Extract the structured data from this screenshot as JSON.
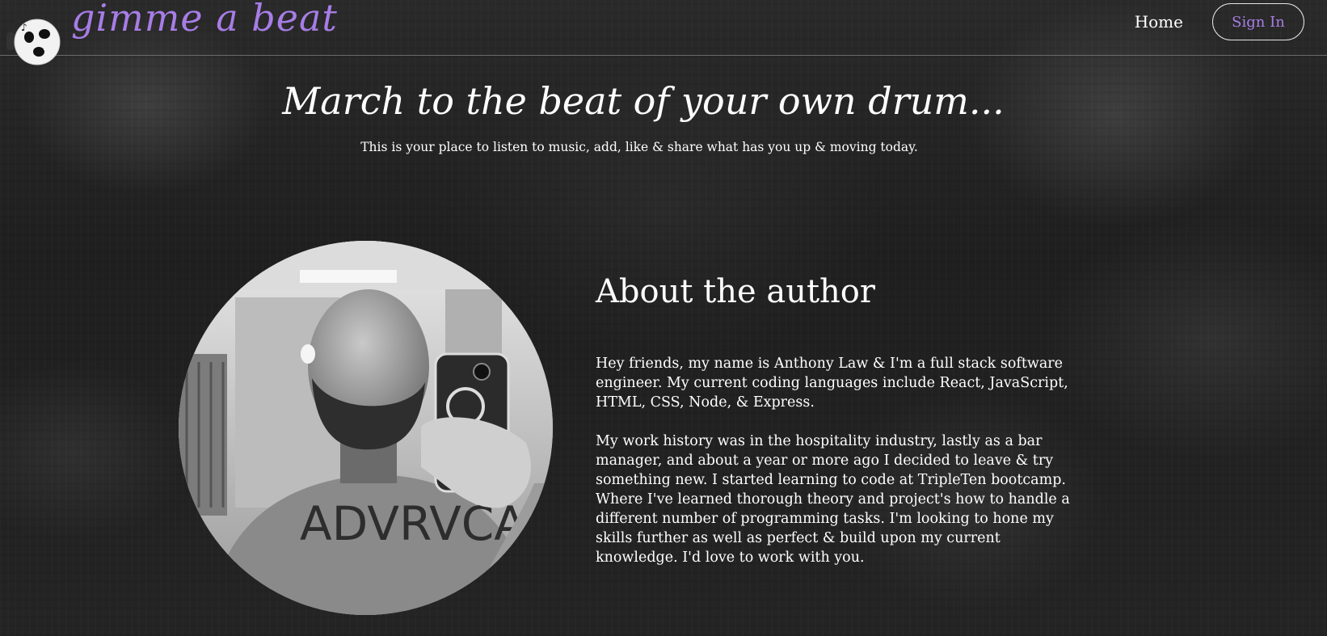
{
  "header": {
    "brand": "gimme a beat",
    "nav_home": "Home",
    "sign_in": "Sign In"
  },
  "hero": {
    "title": "March to the beat of your own drum...",
    "subtitle": "This is your place to listen to music, add, like & share what has you up & moving today."
  },
  "about": {
    "title": "About the author",
    "paragraphs": [
      "Hey friends, my name is Anthony Law & I'm a full stack software engineer. My current coding languages include React, JavaScript, HTML, CSS, Node, & Express.",
      "My work history was in the hospitality industry, lastly as a bar manager, and about a year or more ago I decided to leave & try something new. I started learning to code at TripleTen bootcamp. Where I've learned thorough theory and project's how to handle a different number of programming tasks. I'm looking to hone my skills further as well as perfect & build upon my current knowledge. I'd love to work with you."
    ],
    "photo_shirt_text": "ADVRVCA"
  },
  "colors": {
    "accent": "#a77de6",
    "text": "#ffffff",
    "background": "#222222"
  },
  "icons": {
    "logo": "music-ball-headphones-icon"
  }
}
